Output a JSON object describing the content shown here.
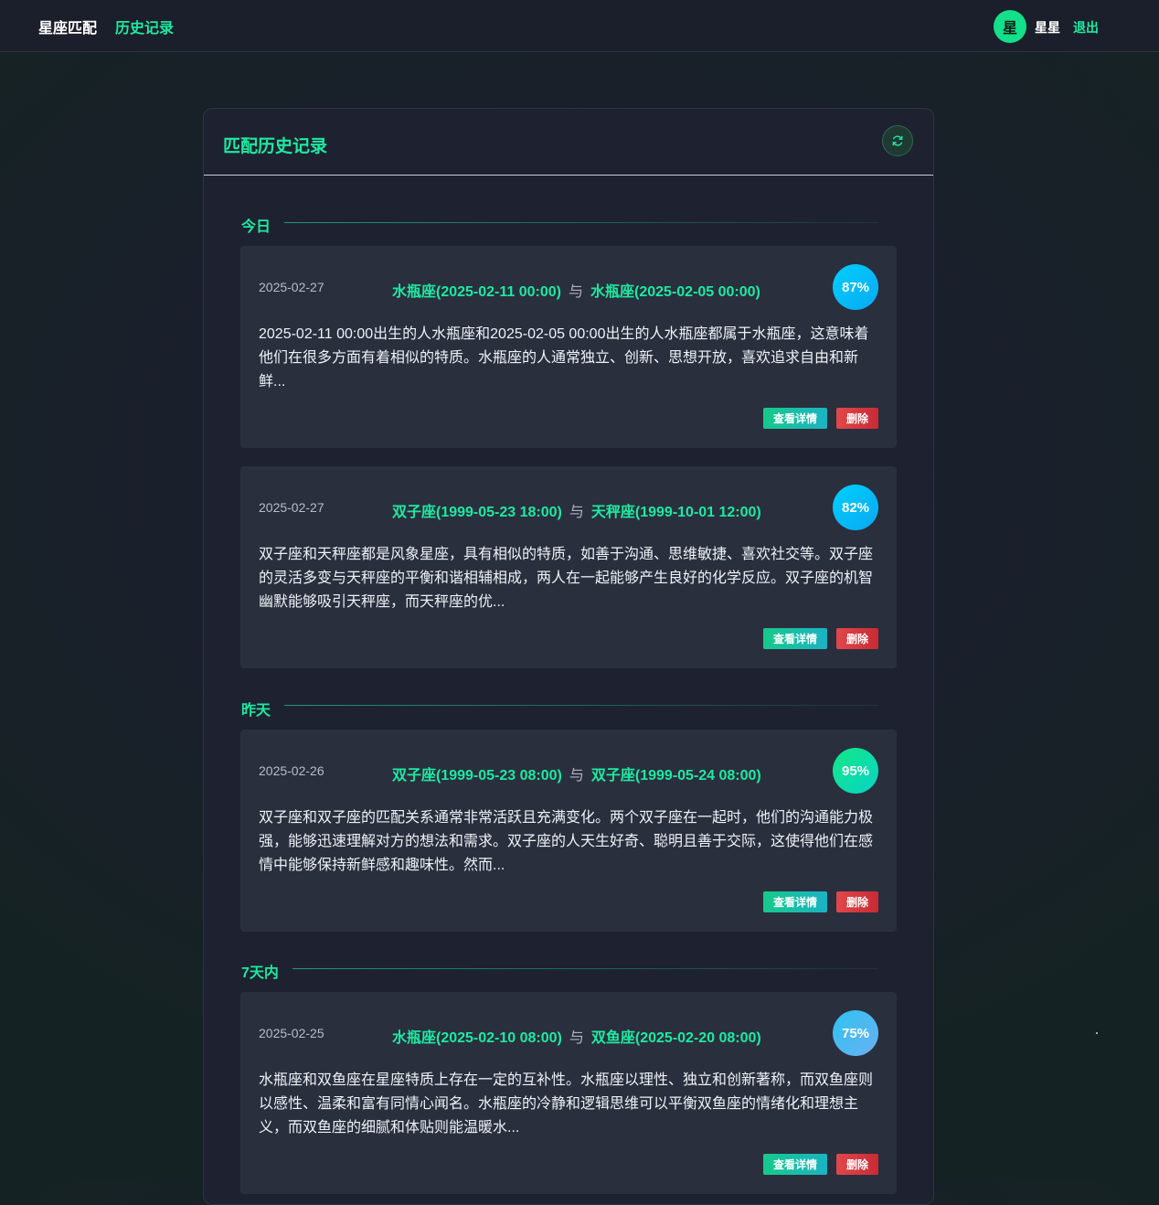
{
  "nav": {
    "brand": "星座匹配",
    "history": "历史记录",
    "avatar_char": "星",
    "username": "星星",
    "logout": "退出"
  },
  "panel": {
    "title": "匹配历史记录",
    "refresh_icon": "refresh-icon"
  },
  "groups": [
    {
      "label": "今日"
    },
    {
      "label": "昨天"
    },
    {
      "label": "7天内"
    }
  ],
  "connector": "与",
  "records": [
    {
      "date": "2025-02-27",
      "person_a": "水瓶座(2025-02-11 00:00)",
      "person_b": "水瓶座(2025-02-05 00:00)",
      "score": "87%",
      "description": "2025-02-11 00:00出生的人水瓶座和2025-02-05 00:00出生的人水瓶座都属于水瓶座，这意味着他们在很多方面有着相似的特质。水瓶座的人通常独立、创新、思想开放，喜欢追求自由和新鲜...",
      "detail_label": "查看详情",
      "delete_label": "删除"
    },
    {
      "date": "2025-02-27",
      "person_a": "双子座(1999-05-23 18:00)",
      "person_b": "天秤座(1999-10-01 12:00)",
      "score": "82%",
      "description": "双子座和天秤座都是风象星座，具有相似的特质，如善于沟通、思维敏捷、喜欢社交等。双子座的灵活多变与天秤座的平衡和谐相辅相成，两人在一起能够产生良好的化学反应。双子座的机智幽默能够吸引天秤座，而天秤座的优...",
      "detail_label": "查看详情",
      "delete_label": "删除"
    },
    {
      "date": "2025-02-26",
      "person_a": "双子座(1999-05-23 08:00)",
      "person_b": "双子座(1999-05-24 08:00)",
      "score": "95%",
      "description": "双子座和双子座的匹配关系通常非常活跃且充满变化。两个双子座在一起时，他们的沟通能力极强，能够迅速理解对方的想法和需求。双子座的人天生好奇、聪明且善于交际，这使得他们在感情中能够保持新鲜感和趣味性。然而...",
      "detail_label": "查看详情",
      "delete_label": "删除"
    },
    {
      "date": "2025-02-25",
      "person_a": "水瓶座(2025-02-10 08:00)",
      "person_b": "双鱼座(2025-02-20 08:00)",
      "score": "75%",
      "description": "水瓶座和双鱼座在星座特质上存在一定的互补性。水瓶座以理性、独立和创新著称，而双鱼座则以感性、温柔和富有同情心闻名。水瓶座的冷静和逻辑思维可以平衡双鱼座的情绪化和理想主义，而双鱼座的细腻和体贴则能温暖水...",
      "detail_label": "查看详情",
      "delete_label": "删除"
    }
  ],
  "colors": {
    "accent": "#1de9a0",
    "score_87": "#0bbdf5",
    "score_82": "#0bbdf5",
    "score_95": "#12e8b0",
    "score_75": "#3fb4f0",
    "delete": "#d8393f"
  }
}
